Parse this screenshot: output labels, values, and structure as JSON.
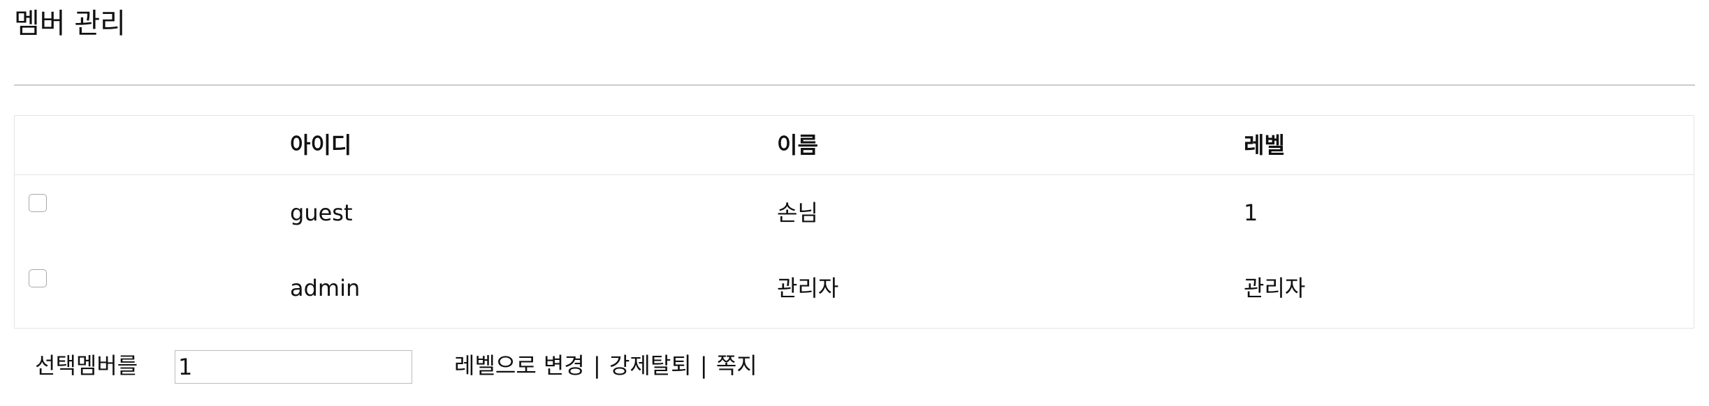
{
  "page": {
    "title": "멤버 관리"
  },
  "table": {
    "columns": [
      "아이디",
      "이름",
      "레벨"
    ],
    "rows": [
      {
        "id": "guest",
        "name": "손님",
        "level": "1"
      },
      {
        "id": "admin",
        "name": "관리자",
        "level": "관리자"
      }
    ]
  },
  "actions": {
    "selected_label": "선택멤버를",
    "level_input_value": "1",
    "change_level_label": "레벨으로 변경",
    "separator": "|",
    "force_withdraw_label": "강제탈퇴",
    "message_label": "쪽지"
  }
}
